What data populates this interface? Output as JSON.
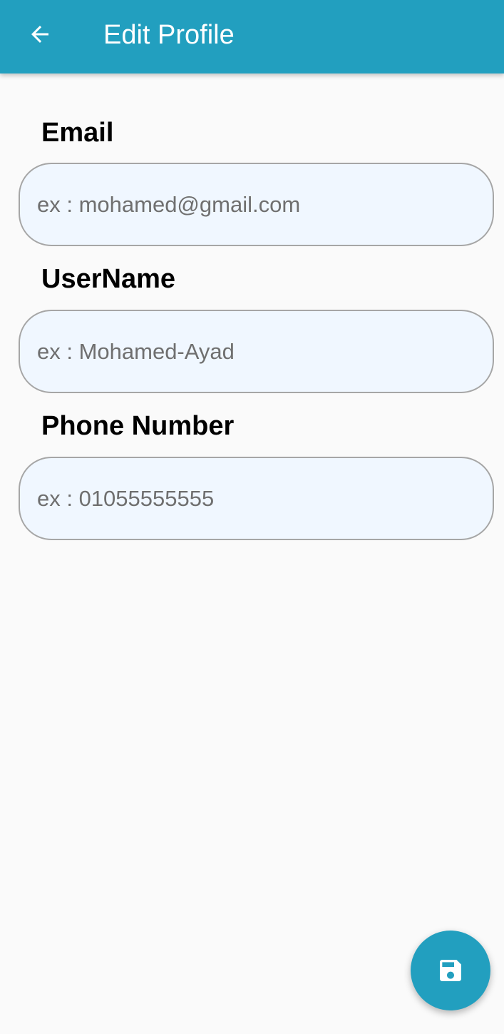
{
  "app_bar": {
    "title": "Edit Profile",
    "back_icon": "arrow-back-icon",
    "background_color": "#229fbf",
    "title_color": "#ffffff"
  },
  "form": {
    "fields": [
      {
        "label": "Email",
        "placeholder": "ex : mohamed@gmail.com",
        "value": ""
      },
      {
        "label": "UserName",
        "placeholder": "ex : Mohamed-Ayad",
        "value": ""
      },
      {
        "label": "Phone Number",
        "placeholder": "ex : 01055555555",
        "value": ""
      }
    ],
    "input_background_color": "#f0f7ff",
    "input_border_color": "#a6a6a6"
  },
  "fab": {
    "icon": "save-icon",
    "background_color": "#229fbf"
  }
}
